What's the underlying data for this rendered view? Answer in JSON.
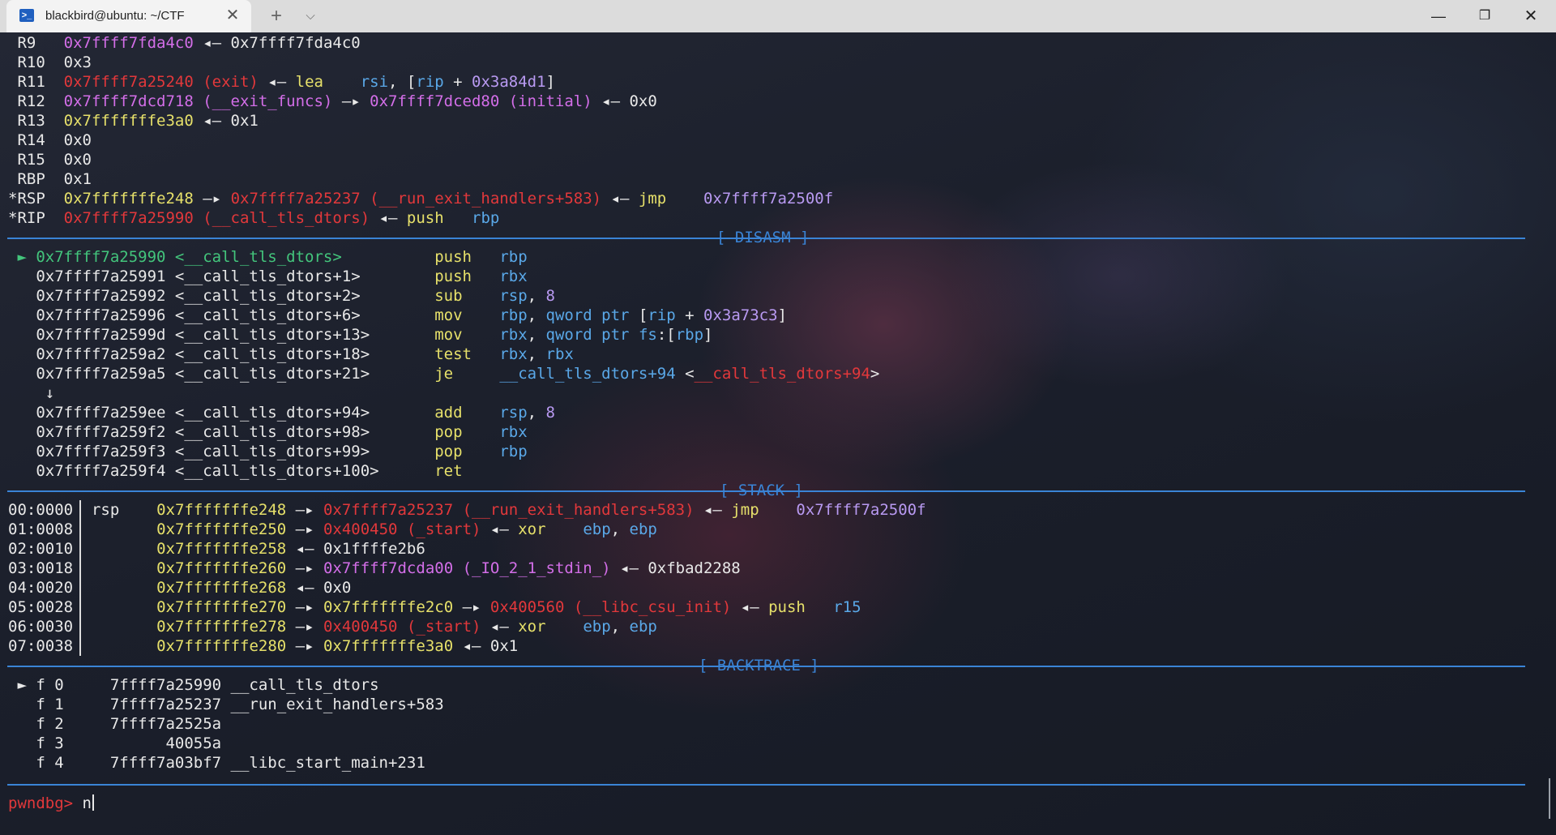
{
  "window": {
    "tab_title": "blackbird@ubuntu: ~/CTF",
    "tab_icon": "terminal-icon",
    "close_tab_glyph": "✕",
    "new_tab_glyph": "+",
    "tab_menu_glyph": "⌵",
    "minimize_glyph": "—",
    "maximize_glyph": "❐",
    "close_glyph": "✕"
  },
  "registers": [
    {
      "name": "R9",
      "parts": [
        [
          "m",
          "0x7ffff7fda4c0"
        ],
        [
          "w",
          " ◂— 0x7ffff7fda4c0"
        ]
      ]
    },
    {
      "name": "R10",
      "parts": [
        [
          "w",
          "0x3"
        ]
      ]
    },
    {
      "name": "R11",
      "parts": [
        [
          "r",
          "0x7ffff7a25240 (exit)"
        ],
        [
          "w",
          " ◂— "
        ],
        [
          "y",
          "lea"
        ],
        [
          "w",
          "    "
        ],
        [
          "b",
          "rsi"
        ],
        [
          "w",
          ", ["
        ],
        [
          "b",
          "rip"
        ],
        [
          "w",
          " + "
        ],
        [
          "v",
          "0x3a84d1"
        ],
        [
          "w",
          "]"
        ]
      ]
    },
    {
      "name": "R12",
      "parts": [
        [
          "m",
          "0x7ffff7dcd718 (__exit_funcs)"
        ],
        [
          "w",
          " —▸ "
        ],
        [
          "m",
          "0x7ffff7dced80 (initial)"
        ],
        [
          "w",
          " ◂— 0x0"
        ]
      ]
    },
    {
      "name": "R13",
      "parts": [
        [
          "y",
          "0x7fffffffe3a0"
        ],
        [
          "w",
          " ◂— 0x1"
        ]
      ]
    },
    {
      "name": "R14",
      "parts": [
        [
          "w",
          "0x0"
        ]
      ]
    },
    {
      "name": "R15",
      "parts": [
        [
          "w",
          "0x0"
        ]
      ]
    },
    {
      "name": "RBP",
      "parts": [
        [
          "w",
          "0x1"
        ]
      ]
    },
    {
      "name": "*RSP",
      "parts": [
        [
          "y",
          "0x7fffffffe248"
        ],
        [
          "w",
          " —▸ "
        ],
        [
          "r",
          "0x7ffff7a25237 (__run_exit_handlers+583)"
        ],
        [
          "w",
          " ◂— "
        ],
        [
          "y",
          "jmp"
        ],
        [
          "w",
          "    "
        ],
        [
          "v",
          "0x7ffff7a2500f"
        ]
      ]
    },
    {
      "name": "*RIP",
      "parts": [
        [
          "r",
          "0x7ffff7a25990 (__call_tls_dtors)"
        ],
        [
          "w",
          " ◂— "
        ],
        [
          "y",
          "push"
        ],
        [
          "w",
          "   "
        ],
        [
          "b",
          "rbp"
        ]
      ]
    }
  ],
  "sections": {
    "disasm": "[ DISASM ]",
    "stack": "[ STACK ]",
    "backtrace": "[ BACKTRACE ]"
  },
  "disasm": [
    {
      "marker": " ► ",
      "addr": "0x7ffff7a25990 <__call_tls_dtors>    ",
      "current": true,
      "ops": [
        [
          "y",
          "push"
        ],
        [
          "w",
          "   "
        ],
        [
          "b",
          "rbp"
        ]
      ]
    },
    {
      "marker": "   ",
      "addr": "0x7ffff7a25991 <__call_tls_dtors+1>  ",
      "current": false,
      "ops": [
        [
          "y",
          "push"
        ],
        [
          "w",
          "   "
        ],
        [
          "b",
          "rbx"
        ]
      ]
    },
    {
      "marker": "   ",
      "addr": "0x7ffff7a25992 <__call_tls_dtors+2>  ",
      "current": false,
      "ops": [
        [
          "y",
          "sub"
        ],
        [
          "w",
          "    "
        ],
        [
          "b",
          "rsp"
        ],
        [
          "w",
          ", "
        ],
        [
          "v",
          "8"
        ]
      ]
    },
    {
      "marker": "   ",
      "addr": "0x7ffff7a25996 <__call_tls_dtors+6>  ",
      "current": false,
      "ops": [
        [
          "y",
          "mov"
        ],
        [
          "w",
          "    "
        ],
        [
          "b",
          "rbp"
        ],
        [
          "w",
          ", "
        ],
        [
          "b",
          "qword ptr"
        ],
        [
          "w",
          " ["
        ],
        [
          "b",
          "rip"
        ],
        [
          "w",
          " + "
        ],
        [
          "v",
          "0x3a73c3"
        ],
        [
          "w",
          "]"
        ]
      ]
    },
    {
      "marker": "   ",
      "addr": "0x7ffff7a2599d <__call_tls_dtors+13> ",
      "current": false,
      "ops": [
        [
          "y",
          "mov"
        ],
        [
          "w",
          "    "
        ],
        [
          "b",
          "rbx"
        ],
        [
          "w",
          ", "
        ],
        [
          "b",
          "qword ptr"
        ],
        [
          "w",
          " "
        ],
        [
          "b",
          "fs"
        ],
        [
          "w",
          ":["
        ],
        [
          "b",
          "rbp"
        ],
        [
          "w",
          "]"
        ]
      ]
    },
    {
      "marker": "   ",
      "addr": "0x7ffff7a259a2 <__call_tls_dtors+18> ",
      "current": false,
      "ops": [
        [
          "y",
          "test"
        ],
        [
          "w",
          "   "
        ],
        [
          "b",
          "rbx"
        ],
        [
          "w",
          ", "
        ],
        [
          "b",
          "rbx"
        ]
      ]
    },
    {
      "marker": "   ",
      "addr": "0x7ffff7a259a5 <__call_tls_dtors+21> ",
      "current": false,
      "ops": [
        [
          "y",
          "je"
        ],
        [
          "w",
          "     "
        ],
        [
          "b",
          "__call_tls_dtors+94"
        ],
        [
          "w",
          " <"
        ],
        [
          "r",
          "__call_tls_dtors+94"
        ],
        [
          "w",
          ">"
        ]
      ]
    },
    {
      "marker": "    ",
      "addr": "↓",
      "current": false,
      "ops": []
    },
    {
      "marker": "   ",
      "addr": "0x7ffff7a259ee <__call_tls_dtors+94> ",
      "current": false,
      "ops": [
        [
          "y",
          "add"
        ],
        [
          "w",
          "    "
        ],
        [
          "b",
          "rsp"
        ],
        [
          "w",
          ", "
        ],
        [
          "v",
          "8"
        ]
      ]
    },
    {
      "marker": "   ",
      "addr": "0x7ffff7a259f2 <__call_tls_dtors+98> ",
      "current": false,
      "ops": [
        [
          "y",
          "pop"
        ],
        [
          "w",
          "    "
        ],
        [
          "b",
          "rbx"
        ]
      ]
    },
    {
      "marker": "   ",
      "addr": "0x7ffff7a259f3 <__call_tls_dtors+99> ",
      "current": false,
      "ops": [
        [
          "y",
          "pop"
        ],
        [
          "w",
          "    "
        ],
        [
          "b",
          "rbp"
        ]
      ]
    },
    {
      "marker": "   ",
      "addr": "0x7ffff7a259f4 <__call_tls_dtors+100>",
      "current": false,
      "ops": [
        [
          "y",
          "ret"
        ]
      ]
    }
  ],
  "stack": [
    {
      "off": "00:0000",
      "reg": "rsp",
      "parts": [
        [
          "y",
          "0x7fffffffe248"
        ],
        [
          "w",
          " —▸ "
        ],
        [
          "r",
          "0x7ffff7a25237 (__run_exit_handlers+583)"
        ],
        [
          "w",
          " ◂— "
        ],
        [
          "y",
          "jmp"
        ],
        [
          "w",
          "    "
        ],
        [
          "v",
          "0x7ffff7a2500f"
        ]
      ]
    },
    {
      "off": "01:0008",
      "reg": "",
      "parts": [
        [
          "y",
          "0x7fffffffe250"
        ],
        [
          "w",
          " —▸ "
        ],
        [
          "r",
          "0x400450 (_start)"
        ],
        [
          "w",
          " ◂— "
        ],
        [
          "y",
          "xor"
        ],
        [
          "w",
          "    "
        ],
        [
          "b",
          "ebp"
        ],
        [
          "w",
          ", "
        ],
        [
          "b",
          "ebp"
        ]
      ]
    },
    {
      "off": "02:0010",
      "reg": "",
      "parts": [
        [
          "y",
          "0x7fffffffe258"
        ],
        [
          "w",
          " ◂— 0x1ffffe2b6"
        ]
      ]
    },
    {
      "off": "03:0018",
      "reg": "",
      "parts": [
        [
          "y",
          "0x7fffffffe260"
        ],
        [
          "w",
          " —▸ "
        ],
        [
          "m",
          "0x7ffff7dcda00 (_IO_2_1_stdin_)"
        ],
        [
          "w",
          " ◂— 0xfbad2288"
        ]
      ]
    },
    {
      "off": "04:0020",
      "reg": "",
      "parts": [
        [
          "y",
          "0x7fffffffe268"
        ],
        [
          "w",
          " ◂— 0x0"
        ]
      ]
    },
    {
      "off": "05:0028",
      "reg": "",
      "parts": [
        [
          "y",
          "0x7fffffffe270"
        ],
        [
          "w",
          " —▸ "
        ],
        [
          "y",
          "0x7fffffffe2c0"
        ],
        [
          "w",
          " —▸ "
        ],
        [
          "r",
          "0x400560 (__libc_csu_init)"
        ],
        [
          "w",
          " ◂— "
        ],
        [
          "y",
          "push"
        ],
        [
          "w",
          "   "
        ],
        [
          "b",
          "r15"
        ]
      ]
    },
    {
      "off": "06:0030",
      "reg": "",
      "parts": [
        [
          "y",
          "0x7fffffffe278"
        ],
        [
          "w",
          " —▸ "
        ],
        [
          "r",
          "0x400450 (_start)"
        ],
        [
          "w",
          " ◂— "
        ],
        [
          "y",
          "xor"
        ],
        [
          "w",
          "    "
        ],
        [
          "b",
          "ebp"
        ],
        [
          "w",
          ", "
        ],
        [
          "b",
          "ebp"
        ]
      ]
    },
    {
      "off": "07:0038",
      "reg": "",
      "parts": [
        [
          "y",
          "0x7fffffffe280"
        ],
        [
          "w",
          " —▸ "
        ],
        [
          "y",
          "0x7fffffffe3a0"
        ],
        [
          "w",
          " ◂— 0x1"
        ]
      ]
    }
  ],
  "backtrace": [
    {
      "text": " ► f 0     7ffff7a25990 __call_tls_dtors"
    },
    {
      "text": "   f 1     7ffff7a25237 __run_exit_handlers+583"
    },
    {
      "text": "   f 2     7ffff7a2525a"
    },
    {
      "text": "   f 3           40055a"
    },
    {
      "text": "   f 4     7ffff7a03bf7 __libc_start_main+231"
    }
  ],
  "prompt": {
    "label": "pwndbg> ",
    "input": "n"
  },
  "colors": {
    "white": "#e8e8e8",
    "magenta": "#d36ee8",
    "red": "#e2383b",
    "yellow": "#e6e06a",
    "green": "#43c57c",
    "blue": "#5aa8e8",
    "violet": "#b99af2",
    "separator": "#3a84d6"
  }
}
